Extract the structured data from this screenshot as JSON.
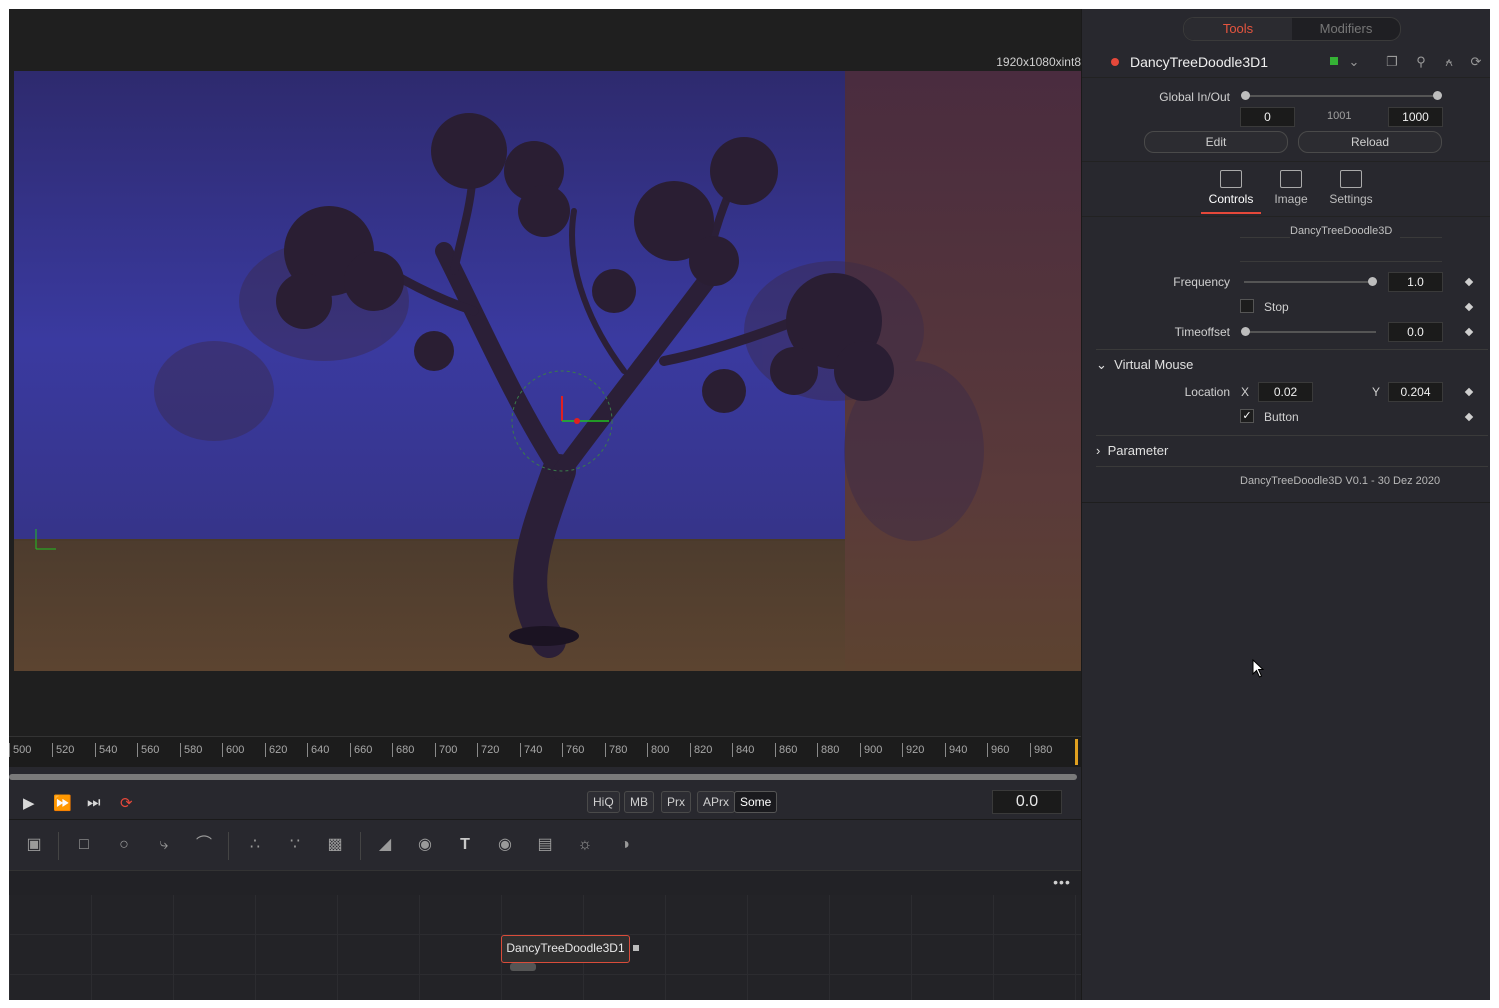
{
  "viewer": {
    "resolution": "1920x1080xint8"
  },
  "timeline": {
    "ticks": [
      "500",
      "520",
      "540",
      "560",
      "580",
      "600",
      "620",
      "640",
      "660",
      "680",
      "700",
      "720",
      "740",
      "760",
      "780",
      "800",
      "820",
      "840",
      "860",
      "880",
      "900",
      "920",
      "940",
      "960",
      "980"
    ]
  },
  "transport": {
    "quality_buttons": [
      "HiQ",
      "MB",
      "Prx",
      "APrx",
      "Some"
    ],
    "current_time": "0.0"
  },
  "node": {
    "label": "DancyTreeDoodle3D1"
  },
  "inspector": {
    "tabs_top": {
      "tools": "Tools",
      "modifiers": "Modifiers"
    },
    "tool_name": "DancyTreeDoodle3D1",
    "global_inout": {
      "label": "Global In/Out",
      "start": "0",
      "mid": "1001",
      "end": "1000"
    },
    "edit_label": "Edit",
    "reload_label": "Reload",
    "panel_tabs": [
      "Controls",
      "Image",
      "Settings"
    ],
    "header_text": "DancyTreeDoodle3D",
    "frequency": {
      "label": "Frequency",
      "value": "1.0"
    },
    "stop": {
      "label": "Stop",
      "checked": false
    },
    "timeoffset": {
      "label": "Timeoffset",
      "value": "0.0"
    },
    "virtual_mouse": {
      "label": "Virtual Mouse",
      "location_label": "Location",
      "x_label": "X",
      "x_value": "0.02",
      "y_label": "Y",
      "y_value": "0.204",
      "button_label": "Button",
      "button_checked": true
    },
    "parameter_label": "Parameter",
    "version_text": "DancyTreeDoodle3D V0.1 - 30 Dez 2020"
  },
  "colors": {
    "accent_red": "#e5483a",
    "status_green": "#35b235",
    "panel_bg": "#28282e"
  },
  "icons": [
    "play-icon",
    "fast-forward-icon",
    "skip-end-icon",
    "loop-icon",
    "transform-icon",
    "rectangle-icon",
    "ellipse-icon",
    "polygon-icon",
    "bspline-icon",
    "particle-emitter-icon",
    "particle-render-icon",
    "particle-icon",
    "shape3d-icon",
    "merge3d-icon",
    "text3d-icon",
    "camera3d-icon",
    "renderer3d-icon",
    "spotlight-icon",
    "ambient-light-icon",
    "more-icon"
  ]
}
